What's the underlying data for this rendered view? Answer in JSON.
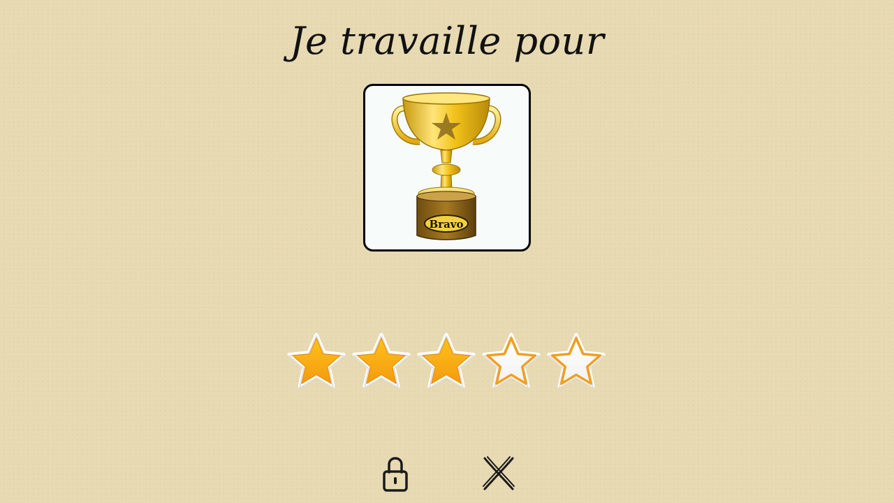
{
  "header": {
    "title": "Je travaille pour"
  },
  "reward": {
    "name": "Bravo",
    "icon": "trophy-icon"
  },
  "rating": {
    "filled": 3,
    "total": 5,
    "filled_color": "#f39a10",
    "empty_color": "#ffffff",
    "outline_color": "#f0a020"
  },
  "controls": {
    "lock_icon": "lock-icon",
    "close_icon": "close-icon"
  }
}
